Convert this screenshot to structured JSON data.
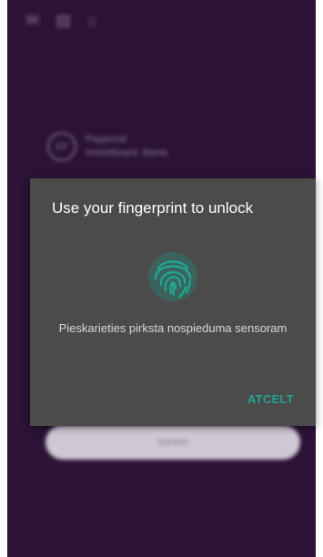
{
  "background": {
    "status_icons": [
      "mail-icon",
      "sim-icon",
      "lock-icon"
    ],
    "account": {
      "initials": "LV",
      "line1": "Paypocel",
      "line2": "Investboant: Banis"
    },
    "button_label": "Sanket"
  },
  "dialog": {
    "title": "Use your fingerprint to unlock",
    "message": "Pieskarieties pirksta nospieduma sensoram",
    "action_label": "ATCELT",
    "accent_color": "#20a591",
    "icon": "fingerprint-icon"
  }
}
